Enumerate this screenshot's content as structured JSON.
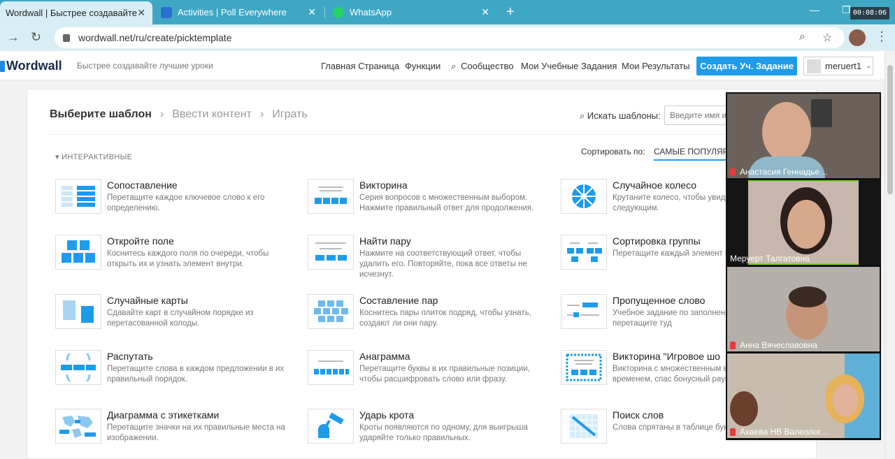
{
  "browser": {
    "tabs": [
      {
        "title": "Wordwall | Быстрее создавайте",
        "active": true
      },
      {
        "title": "Activities | Poll Everywhere",
        "active": false
      },
      {
        "title": "WhatsApp",
        "active": false
      }
    ],
    "new_tab": "+",
    "url": "wordwall.net/ru/create/picktemplate",
    "timer": "00:08:06"
  },
  "header": {
    "logo": "Wordwall",
    "tagline": "Быстрее создавайте лучшие уроки",
    "nav": [
      "Главная Страница",
      "Функции",
      "Сообщество",
      "Мои Учебные Задания",
      "Мои Результаты"
    ],
    "create_button": "Создать Уч. Задание",
    "user": "meruert1"
  },
  "main": {
    "steps": [
      "Выберите шаблон",
      "Ввести контент",
      "Играть"
    ],
    "search_label": "Искать шаблоны:",
    "search_placeholder": "Введите имя или",
    "section": "ИНТЕРАКТИВНЫЕ",
    "sort_label": "Сортировать по:",
    "sort_value": "САМЫЕ ПОПУЛЯРН",
    "templates": [
      {
        "name": "Сопоставление",
        "desc": "Перетащите каждое ключевое слово к его определению."
      },
      {
        "name": "Викторина",
        "desc": "Серия вопросов с множественным выбором. Нажмите правильный ответ для продолжения."
      },
      {
        "name": "Случайное колесо",
        "desc": "Крутаните колесо, чтобы увиде будет следующим."
      },
      {
        "name": "Откройте поле",
        "desc": "Коснитесь каждого поля по очереди, чтобы открыть их и узнать элемент внутри."
      },
      {
        "name": "Найти пару",
        "desc": "Нажмите на соответствующий ответ, чтобы удалить его. Повторяйте, пока все ответы не исчезнут."
      },
      {
        "name": "Сортировка группы",
        "desc": "Перетащите каждый элемент в группу."
      },
      {
        "name": "Случайные карты",
        "desc": "Сдавайте карт в случайном порядке из перетасованной колоды."
      },
      {
        "name": "Составление пар",
        "desc": "Коснитесь пары плиток подряд, чтобы узнать, создают ли они пару."
      },
      {
        "name": "Пропущенное слово",
        "desc": "Учебное задание по заполнени слов в тексте - перетащите туд"
      },
      {
        "name": "Распутать",
        "desc": "Перетащите слова в каждом предложении в их правильный порядок."
      },
      {
        "name": "Анаграмма",
        "desc": "Перетащите буквы в их правильные позиции, чтобы расшифровать слово или фразу."
      },
      {
        "name": "Викторина \"Игровое шо",
        "desc": "Викторина с множественным в ограниченным временем, спас бонусный раунд."
      },
      {
        "name": "Диаграмма с этикетками",
        "desc": "Перетащите значки на их правильные места на изображении."
      },
      {
        "name": "Ударь крота",
        "desc": "Кроты появляются по одному, для выигрыша ударяйте только правильных."
      },
      {
        "name": "Поиск слов",
        "desc": "Слова спрятаны в таблице букв можно быстрее."
      }
    ]
  },
  "zoom": {
    "participants": [
      {
        "name": "Анастасия Геннадье…",
        "muted": true
      },
      {
        "name": "Меруерт Талгатовна",
        "muted": false
      },
      {
        "name": "Анна Вячеславовна",
        "muted": true
      },
      {
        "name": "Ахаева НВ Валеолог…",
        "muted": true
      }
    ]
  },
  "colors": {
    "tab_strip": "#3ea8c4",
    "accent": "#1e9be9",
    "speaking": "#7ed321"
  }
}
